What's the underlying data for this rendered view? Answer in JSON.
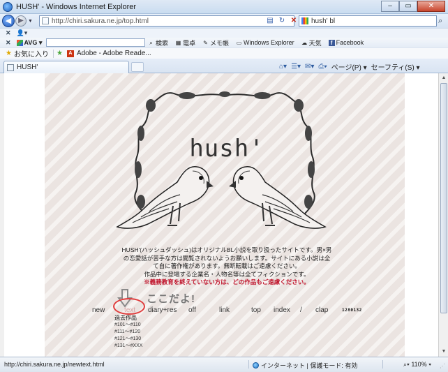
{
  "window": {
    "title": "HUSH' - Windows Internet Explorer"
  },
  "address": {
    "url": "http://chiri.sakura.ne.jp/top.html",
    "search_value": "hush' bl"
  },
  "avg_toolbar": {
    "logo": "AVG",
    "search_label": "検索",
    "items": [
      "電卓",
      "メモ帳",
      "Windows Explorer",
      "天気",
      "Facebook"
    ]
  },
  "favorites": {
    "label": "お気に入り",
    "link": "Adobe - Adobe Reade..."
  },
  "tab": {
    "label": "HUSH'"
  },
  "commands": {
    "page": "ページ(P)",
    "safety": "セーフティ(S)"
  },
  "site": {
    "title": "hush'",
    "intro_lines": [
      "HUSH'(ハッシュダッシュ)はオリジナルBL小説を取り扱ったサイトです。男×男",
      "の恋愛話が苦手な方は閲覧されないようお願いします。サイトにある小説は全",
      "て自に著作権があります。無断転載はご遠慮ください。",
      "作品中に登場する企業名・人物名等は全てフィクションです。"
    ],
    "warning": "※義務教育を終えていない方は、どの作品もご遠慮ください。",
    "annotation": "ここだよ!",
    "nav": [
      "new",
      "text",
      "diary+res",
      "off",
      "link",
      "top",
      "index",
      "/",
      "clap"
    ],
    "counter": "1280132",
    "dropdown_title": "過去作品",
    "dropdown_items": [
      "#101〜#110",
      "#111〜#120",
      "#121〜#130",
      "#131〜#XXX"
    ]
  },
  "status": {
    "url": "http://chiri.sakura.ne.jp/newtext.html",
    "zone": "インターネット | 保護モード: 有効",
    "zoom": "110%"
  }
}
